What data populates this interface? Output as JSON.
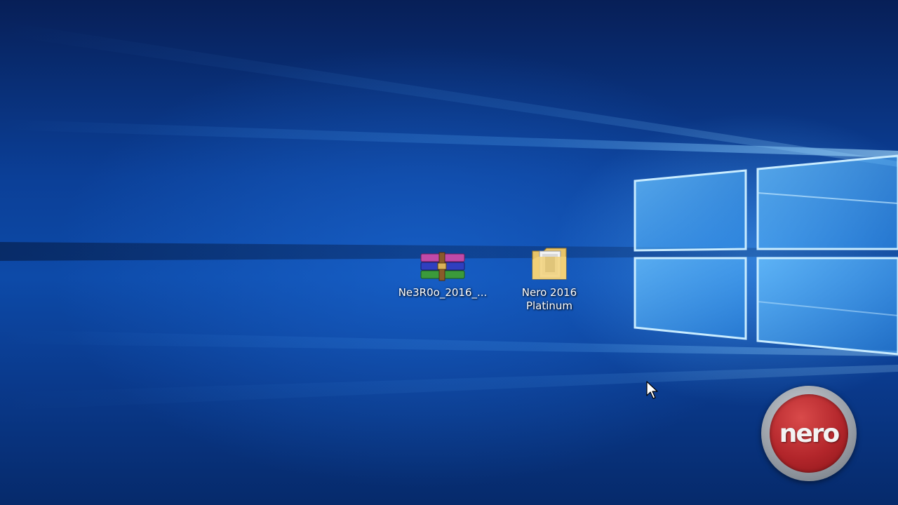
{
  "desktop": {
    "icons": [
      {
        "label": "Ne3R0o_2016_...",
        "icon": "winrar-archive-icon"
      },
      {
        "label": "Nero 2016 Platinum",
        "icon": "folder-icon"
      }
    ]
  },
  "watermark": {
    "text": "nero"
  },
  "colors": {
    "wallpaper_blue": "#0d4aa8",
    "light_beam": "#7cc8ff",
    "nero_red": "#b3262b"
  }
}
